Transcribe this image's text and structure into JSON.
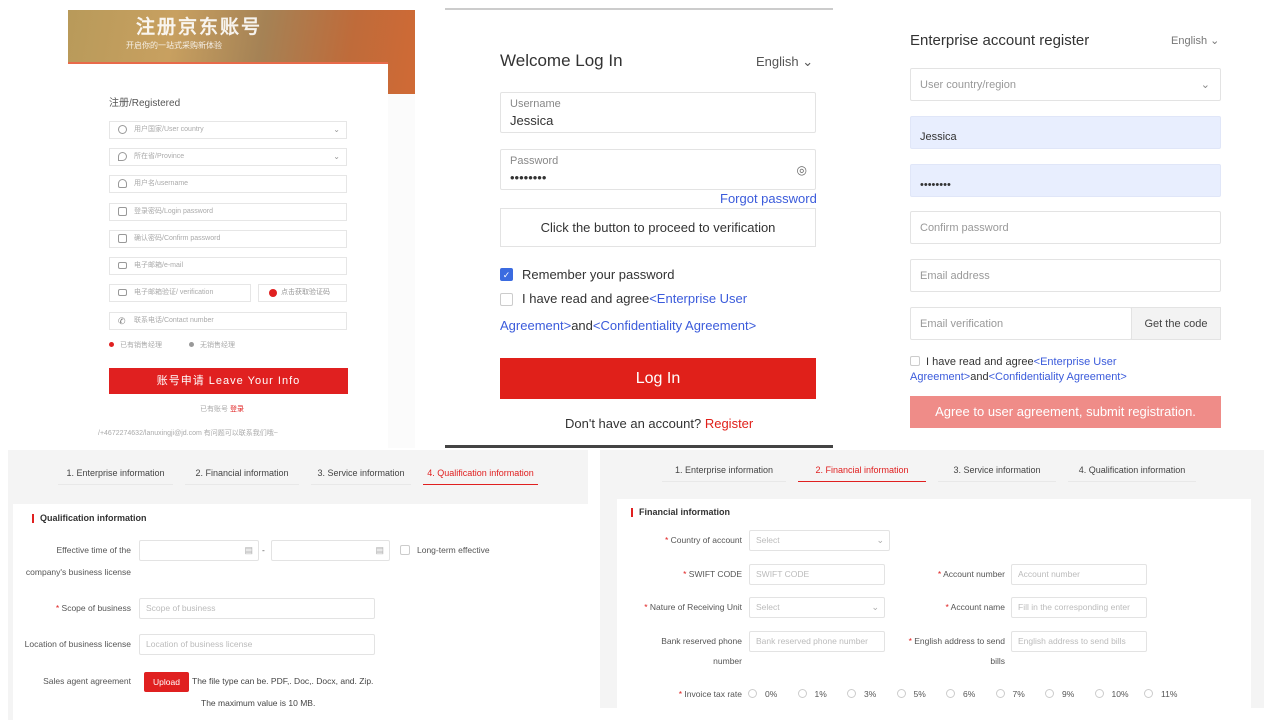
{
  "panel_jd_register": {
    "banner_title": "注册京东账号",
    "banner_subtitle": "开启你的一站式采购新体验",
    "form_title": "注册/Registered",
    "fields": [
      {
        "placeholder": "用户国家/User country",
        "icon": "globe-icon",
        "dropdown": true
      },
      {
        "placeholder": "所在省/Province",
        "icon": "location-icon",
        "dropdown": true
      },
      {
        "placeholder": "用户名/username",
        "icon": "user-icon",
        "dropdown": false
      },
      {
        "placeholder": "登录密码/Login password",
        "icon": "lock-icon",
        "dropdown": false
      },
      {
        "placeholder": "确认密码/Confirm password",
        "icon": "lock-icon",
        "dropdown": false
      },
      {
        "placeholder": "电子邮箱/e-mail",
        "icon": "mail-icon",
        "dropdown": false
      }
    ],
    "verification_placeholder": "电子邮箱验证/ verification",
    "get_code_label": "点击获取验证码",
    "contact_placeholder": "联系电话/Contact number",
    "option_1": "已有销售经理",
    "option_2": "无销售经理",
    "submit_label": "账号申请 Leave Your Info",
    "login_prompt": "已有账号",
    "login_link": "登录",
    "footer": "/+4672274632/lanuxingji@jd.com  有问题可以联系我们哦~"
  },
  "panel_login": {
    "title": "Welcome Log In",
    "language": "English",
    "username_label": "Username",
    "username_value": "Jessica",
    "password_label": "Password",
    "password_value": "••••••••",
    "forgot_password": "Forgot password",
    "verify_button": "Click the button to proceed to verification",
    "remember_label": "Remember your password",
    "remember_checked": true,
    "agree_prefix": "I have read and agree",
    "agree_link_1a": "<Enterprise User",
    "agree_link_1b": "Agreement>",
    "agree_and": "and",
    "agree_link_2": "<Confidentiality Agreement>",
    "agree_checked": false,
    "login_button": "Log In",
    "no_account": "Don't have an account?",
    "register_link": "Register"
  },
  "panel_enterprise_register": {
    "title": "Enterprise account register",
    "language": "English",
    "country_placeholder": "User country/region",
    "username_value": "Jessica",
    "password_value": "••••••••",
    "confirm_placeholder": "Confirm password",
    "email_placeholder": "Email address",
    "email_verify_placeholder": "Email verification",
    "get_code": "Get the code",
    "agree_prefix": "I have read and agree",
    "agree_link_1a": "<Enterprise User",
    "agree_link_1b": "Agreement>",
    "agree_and": "and",
    "agree_link_2": "<Confidentiality Agreement>",
    "submit": "Agree to user agreement, submit registration."
  },
  "steps": [
    "1. Enterprise information",
    "2. Financial information",
    "3. Service information",
    "4. Qualification information"
  ],
  "panel_qualification": {
    "active_step": 3,
    "section_title": "Qualification information",
    "effective_label_1": "Effective time of the",
    "effective_label_2": "company's business license",
    "date_separator": "-",
    "long_term": "Long-term effective",
    "scope_label": "Scope of business",
    "scope_placeholder": "Scope of business",
    "location_label": "Location of business license",
    "location_placeholder": "Location of business license",
    "agreement_label": "Sales agent agreement",
    "upload_button": "Upload",
    "file_hint_1": "The file type can be. PDF,. Doc,. Docx, and. Zip.",
    "file_hint_2": "The maximum value is 10 MB."
  },
  "panel_financial": {
    "active_step": 1,
    "section_title": "Financial information",
    "country_label": "Country of account",
    "country_placeholder": "Select",
    "swift_label": "SWIFT CODE",
    "swift_placeholder": "SWIFT CODE",
    "account_number_label": "Account number",
    "account_number_placeholder": "Account number",
    "nature_label": "Nature of Receiving Unit",
    "nature_placeholder": "Select",
    "account_name_label": "Account name",
    "account_name_placeholder": "Fill in the corresponding enter",
    "bank_phone_label_1": "Bank reserved phone",
    "bank_phone_label_2": "number",
    "bank_phone_placeholder": "Bank reserved phone number",
    "address_label_1": "English address to send",
    "address_label_2": "bills",
    "address_placeholder": "English address to send bills",
    "tax_label": "Invoice tax rate",
    "tax_rates": [
      "0%",
      "1%",
      "3%",
      "5%",
      "6%",
      "7%",
      "9%",
      "10%",
      "11%"
    ]
  },
  "colors": {
    "brand_red": "#e0201a",
    "link_blue": "#3b5bdb",
    "disabled_red": "#ef8c88",
    "autofill_blue": "#e8eefe"
  }
}
